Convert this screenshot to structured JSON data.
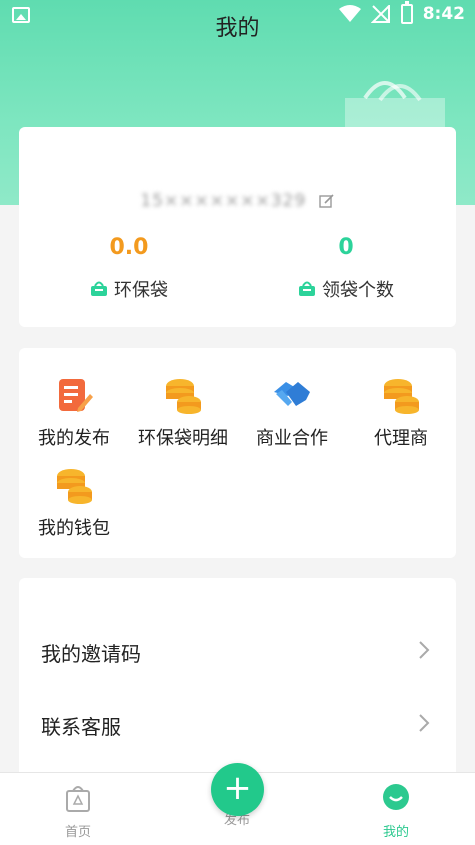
{
  "status_bar": {
    "time": "8:42"
  },
  "header": {
    "title": "我的"
  },
  "profile": {
    "username": "15×××××××329",
    "stats": [
      {
        "value": "0.0",
        "label": "环保袋"
      },
      {
        "value": "0",
        "label": "领袋个数"
      }
    ]
  },
  "menu": [
    {
      "label": "我的发布",
      "icon": "edit-doc-icon"
    },
    {
      "label": "环保袋明细",
      "icon": "coins-icon"
    },
    {
      "label": "商业合作",
      "icon": "handshake-icon"
    },
    {
      "label": "代理商",
      "icon": "coins-icon"
    },
    {
      "label": "我的钱包",
      "icon": "coins-icon"
    }
  ],
  "list": [
    {
      "label": "我的邀请码"
    },
    {
      "label": "联系客服"
    }
  ],
  "tabbar": {
    "home": "首页",
    "publish": "发布",
    "publish_symbol": "+",
    "mine": "我的"
  },
  "colors": {
    "accent": "#2cc98f",
    "orange": "#f39a1e",
    "header": "#6ee0b8"
  }
}
